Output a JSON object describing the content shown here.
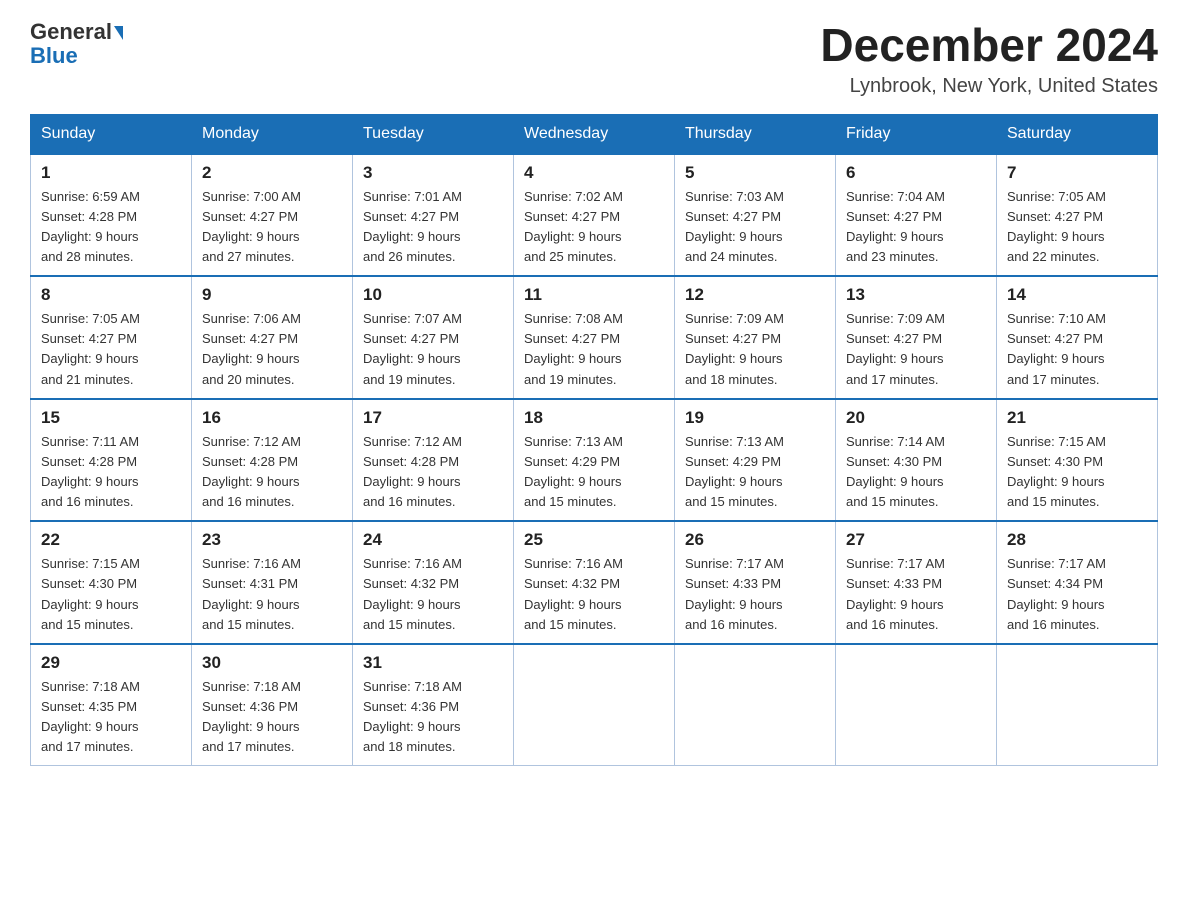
{
  "header": {
    "logo_general": "General",
    "logo_blue": "Blue",
    "month_title": "December 2024",
    "location": "Lynbrook, New York, United States"
  },
  "days_of_week": [
    "Sunday",
    "Monday",
    "Tuesday",
    "Wednesday",
    "Thursday",
    "Friday",
    "Saturday"
  ],
  "weeks": [
    [
      {
        "day": "1",
        "sunrise": "6:59 AM",
        "sunset": "4:28 PM",
        "daylight": "9 hours and 28 minutes."
      },
      {
        "day": "2",
        "sunrise": "7:00 AM",
        "sunset": "4:27 PM",
        "daylight": "9 hours and 27 minutes."
      },
      {
        "day": "3",
        "sunrise": "7:01 AM",
        "sunset": "4:27 PM",
        "daylight": "9 hours and 26 minutes."
      },
      {
        "day": "4",
        "sunrise": "7:02 AM",
        "sunset": "4:27 PM",
        "daylight": "9 hours and 25 minutes."
      },
      {
        "day": "5",
        "sunrise": "7:03 AM",
        "sunset": "4:27 PM",
        "daylight": "9 hours and 24 minutes."
      },
      {
        "day": "6",
        "sunrise": "7:04 AM",
        "sunset": "4:27 PM",
        "daylight": "9 hours and 23 minutes."
      },
      {
        "day": "7",
        "sunrise": "7:05 AM",
        "sunset": "4:27 PM",
        "daylight": "9 hours and 22 minutes."
      }
    ],
    [
      {
        "day": "8",
        "sunrise": "7:05 AM",
        "sunset": "4:27 PM",
        "daylight": "9 hours and 21 minutes."
      },
      {
        "day": "9",
        "sunrise": "7:06 AM",
        "sunset": "4:27 PM",
        "daylight": "9 hours and 20 minutes."
      },
      {
        "day": "10",
        "sunrise": "7:07 AM",
        "sunset": "4:27 PM",
        "daylight": "9 hours and 19 minutes."
      },
      {
        "day": "11",
        "sunrise": "7:08 AM",
        "sunset": "4:27 PM",
        "daylight": "9 hours and 19 minutes."
      },
      {
        "day": "12",
        "sunrise": "7:09 AM",
        "sunset": "4:27 PM",
        "daylight": "9 hours and 18 minutes."
      },
      {
        "day": "13",
        "sunrise": "7:09 AM",
        "sunset": "4:27 PM",
        "daylight": "9 hours and 17 minutes."
      },
      {
        "day": "14",
        "sunrise": "7:10 AM",
        "sunset": "4:27 PM",
        "daylight": "9 hours and 17 minutes."
      }
    ],
    [
      {
        "day": "15",
        "sunrise": "7:11 AM",
        "sunset": "4:28 PM",
        "daylight": "9 hours and 16 minutes."
      },
      {
        "day": "16",
        "sunrise": "7:12 AM",
        "sunset": "4:28 PM",
        "daylight": "9 hours and 16 minutes."
      },
      {
        "day": "17",
        "sunrise": "7:12 AM",
        "sunset": "4:28 PM",
        "daylight": "9 hours and 16 minutes."
      },
      {
        "day": "18",
        "sunrise": "7:13 AM",
        "sunset": "4:29 PM",
        "daylight": "9 hours and 15 minutes."
      },
      {
        "day": "19",
        "sunrise": "7:13 AM",
        "sunset": "4:29 PM",
        "daylight": "9 hours and 15 minutes."
      },
      {
        "day": "20",
        "sunrise": "7:14 AM",
        "sunset": "4:30 PM",
        "daylight": "9 hours and 15 minutes."
      },
      {
        "day": "21",
        "sunrise": "7:15 AM",
        "sunset": "4:30 PM",
        "daylight": "9 hours and 15 minutes."
      }
    ],
    [
      {
        "day": "22",
        "sunrise": "7:15 AM",
        "sunset": "4:30 PM",
        "daylight": "9 hours and 15 minutes."
      },
      {
        "day": "23",
        "sunrise": "7:16 AM",
        "sunset": "4:31 PM",
        "daylight": "9 hours and 15 minutes."
      },
      {
        "day": "24",
        "sunrise": "7:16 AM",
        "sunset": "4:32 PM",
        "daylight": "9 hours and 15 minutes."
      },
      {
        "day": "25",
        "sunrise": "7:16 AM",
        "sunset": "4:32 PM",
        "daylight": "9 hours and 15 minutes."
      },
      {
        "day": "26",
        "sunrise": "7:17 AM",
        "sunset": "4:33 PM",
        "daylight": "9 hours and 16 minutes."
      },
      {
        "day": "27",
        "sunrise": "7:17 AM",
        "sunset": "4:33 PM",
        "daylight": "9 hours and 16 minutes."
      },
      {
        "day": "28",
        "sunrise": "7:17 AM",
        "sunset": "4:34 PM",
        "daylight": "9 hours and 16 minutes."
      }
    ],
    [
      {
        "day": "29",
        "sunrise": "7:18 AM",
        "sunset": "4:35 PM",
        "daylight": "9 hours and 17 minutes."
      },
      {
        "day": "30",
        "sunrise": "7:18 AM",
        "sunset": "4:36 PM",
        "daylight": "9 hours and 17 minutes."
      },
      {
        "day": "31",
        "sunrise": "7:18 AM",
        "sunset": "4:36 PM",
        "daylight": "9 hours and 18 minutes."
      },
      null,
      null,
      null,
      null
    ]
  ],
  "labels": {
    "sunrise": "Sunrise:",
    "sunset": "Sunset:",
    "daylight": "Daylight:"
  }
}
